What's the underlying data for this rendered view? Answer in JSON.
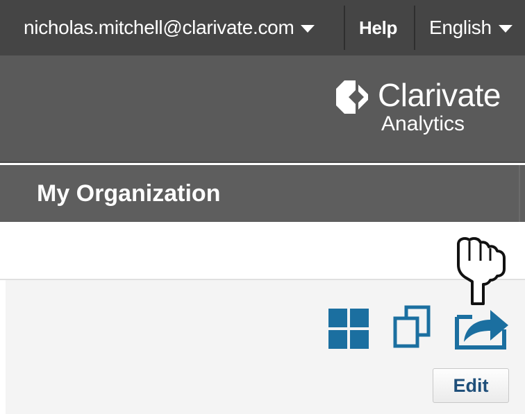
{
  "account_bar": {
    "user_email": "nicholas.mitchell@clarivate.com",
    "help_label": "Help",
    "language_label": "English"
  },
  "brand": {
    "name": "Clarivate",
    "subtitle": "Analytics"
  },
  "nav": {
    "active_item": "My Organization"
  },
  "toolbar": {
    "edit_label": "Edit"
  },
  "icons": {
    "tile_view": "grid-icon",
    "duplicate": "copy-icon",
    "share": "share-icon",
    "cursor": "hand-pointer-icon"
  },
  "colors": {
    "top_bar": "#454545",
    "logo_band": "#5a5a5a",
    "nav_band": "#5e5e5e",
    "icon_blue": "#1b6fa0",
    "edit_text": "#1f4f7a"
  }
}
